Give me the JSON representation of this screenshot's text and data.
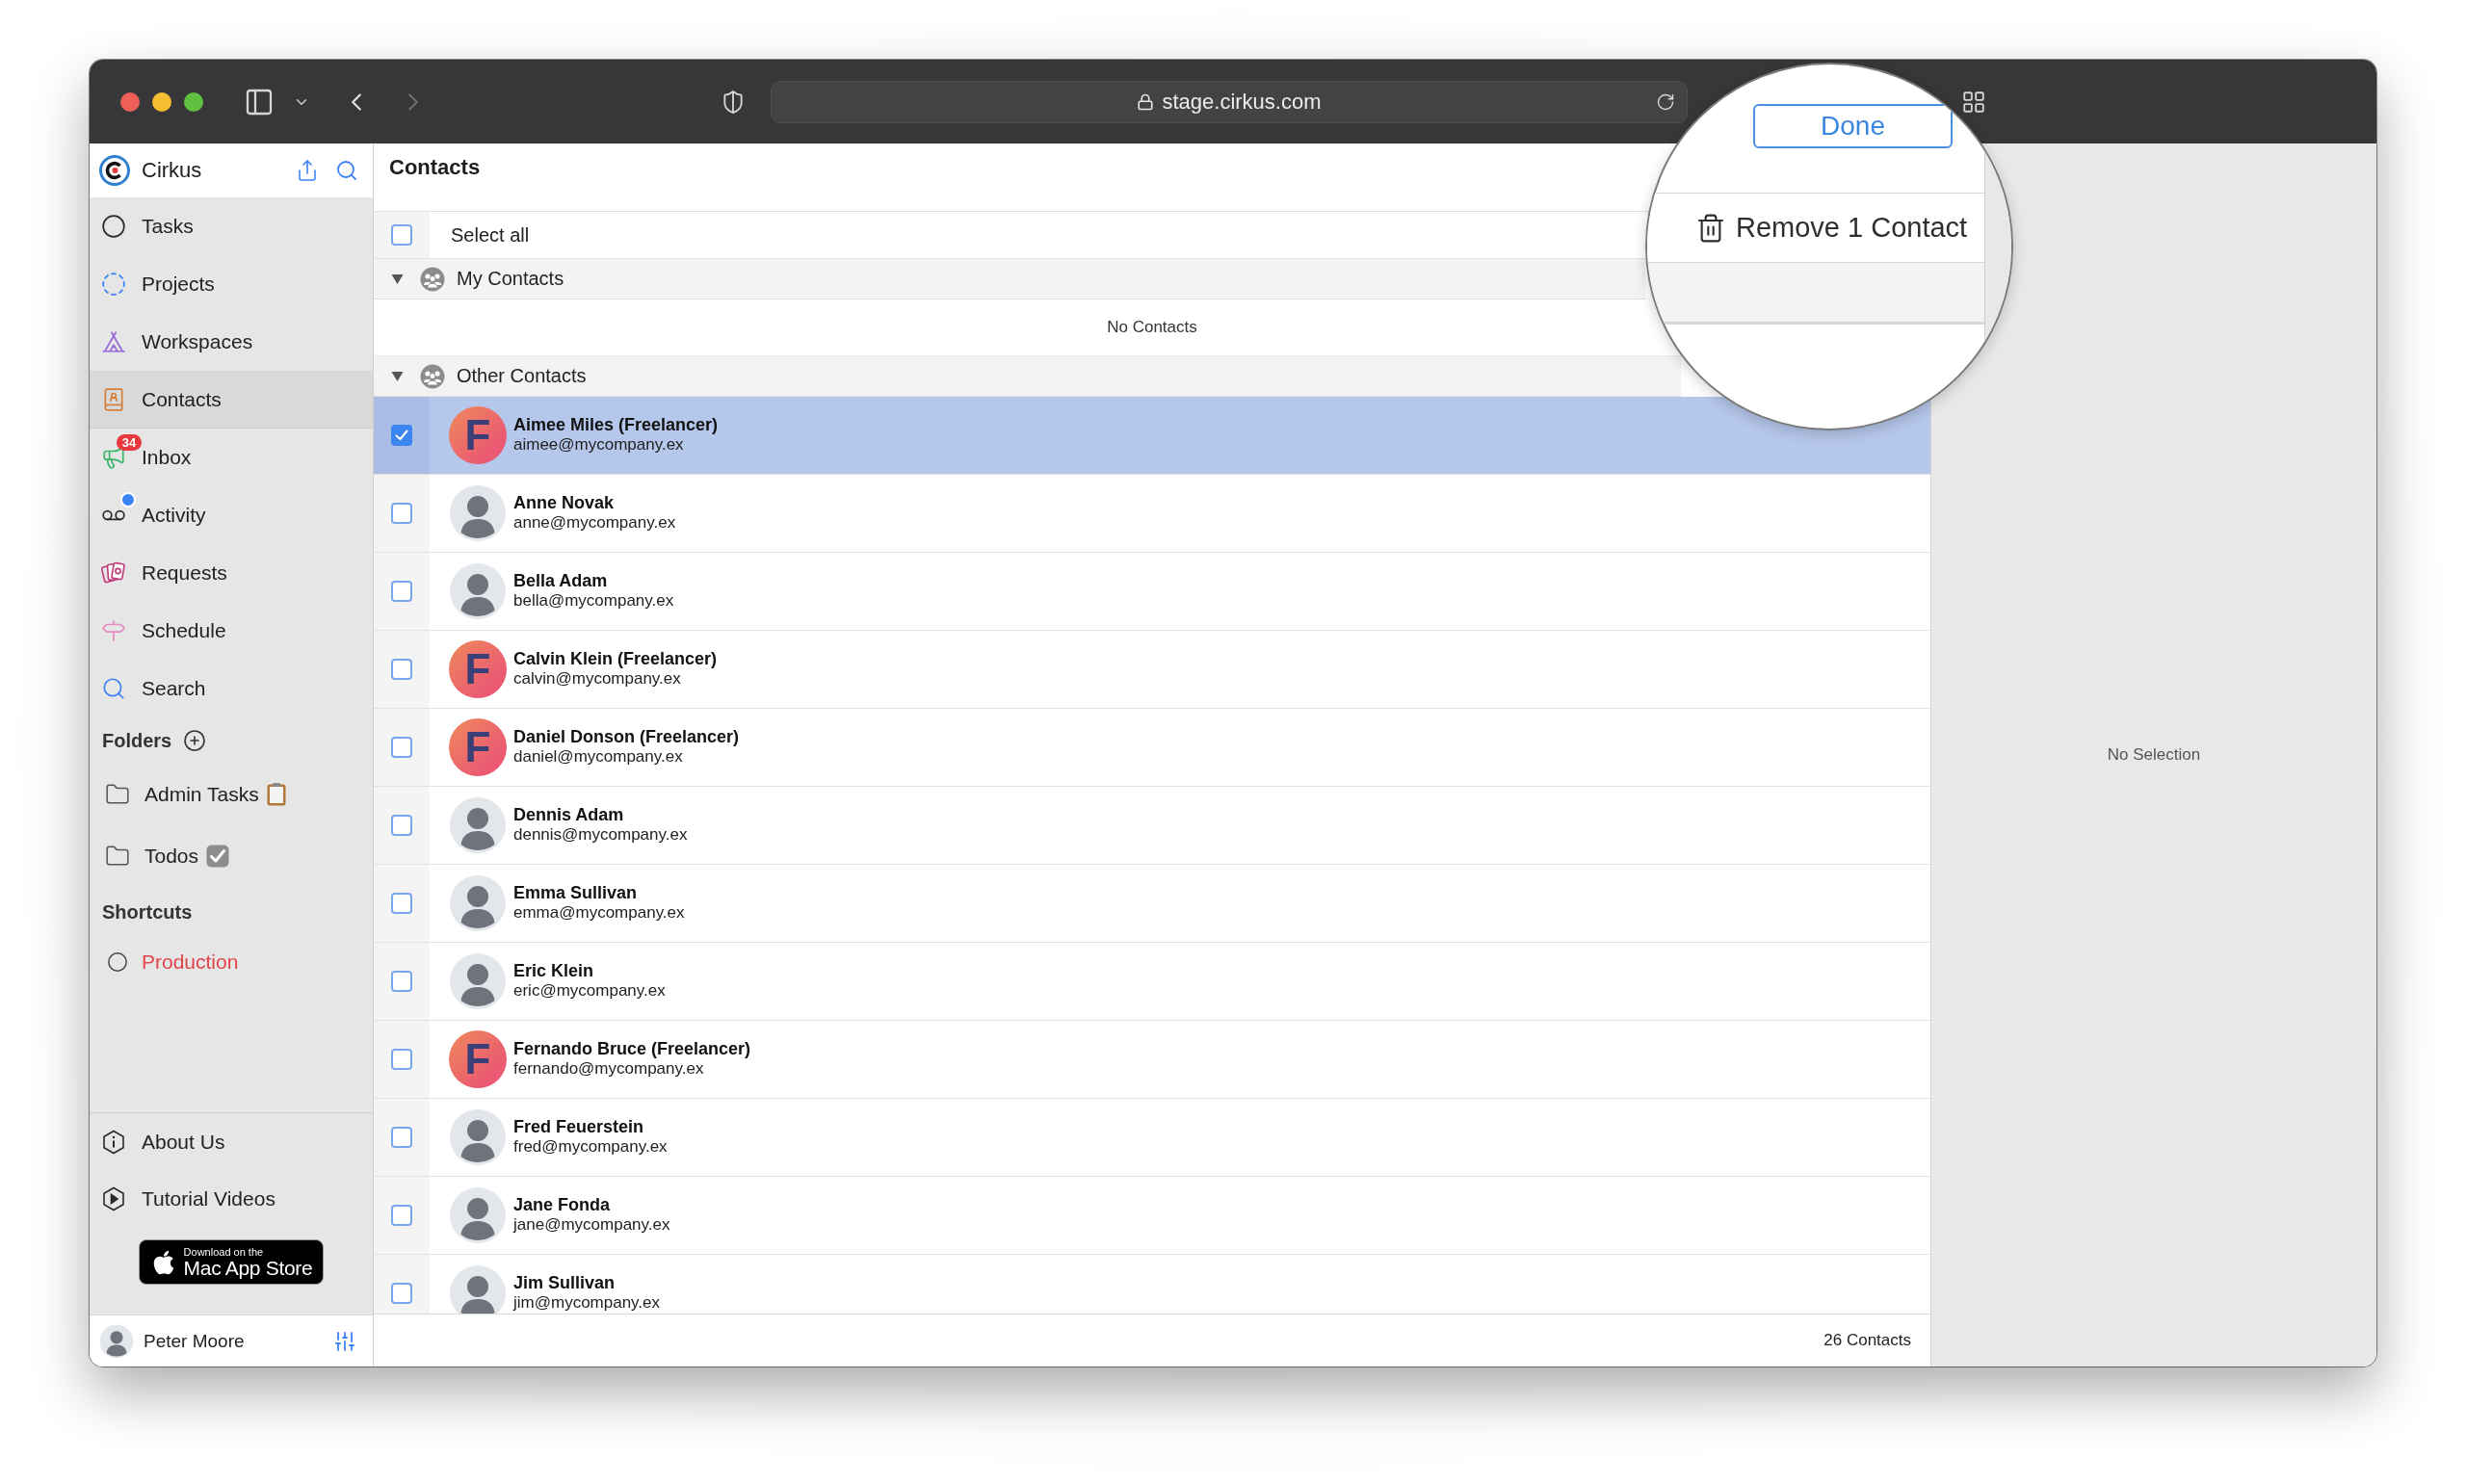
{
  "window": {
    "url": "stage.cirkus.com",
    "back_disabled": false,
    "forward_disabled": true
  },
  "sidebar": {
    "app_name": "Cirkus",
    "items": [
      {
        "label": "Tasks",
        "selected": false,
        "dot": false
      },
      {
        "label": "Projects",
        "selected": false,
        "dot": false
      },
      {
        "label": "Workspaces",
        "selected": false,
        "dot": false
      },
      {
        "label": "Contacts",
        "selected": true,
        "dot": false
      },
      {
        "label": "Inbox",
        "selected": false,
        "dot": false,
        "badge": "34"
      },
      {
        "label": "Activity",
        "selected": false,
        "dot": true
      },
      {
        "label": "Requests",
        "selected": false,
        "dot": false
      },
      {
        "label": "Schedule",
        "selected": false,
        "dot": false
      },
      {
        "label": "Search",
        "selected": false,
        "dot": false
      }
    ],
    "folders": {
      "title": "Folders",
      "items": [
        {
          "label": "Admin Tasks"
        },
        {
          "label": "Todos"
        }
      ]
    },
    "shortcuts": {
      "title": "Shortcuts",
      "items": [
        {
          "label": "Production",
          "color": "#e0444b"
        }
      ]
    },
    "links": [
      {
        "label": "About Us"
      },
      {
        "label": "Tutorial Videos"
      }
    ],
    "app_store": {
      "line_1": "Download on the",
      "line_2": "Mac App Store"
    },
    "user": {
      "name": "Peter Moore"
    }
  },
  "list": {
    "title": "Contacts",
    "select_all": {
      "label": "Select all",
      "checked": false
    },
    "groups": [
      {
        "name": "My Contacts",
        "expanded": true,
        "empty_text": "No Contacts"
      },
      {
        "name": "Other Contacts",
        "expanded": true,
        "contacts": [
          {
            "name": "Aimee Miles (Freelancer)",
            "email": "aimee@mycompany.ex",
            "avatar": {
              "kind": "initial",
              "text": "F"
            },
            "checked": true,
            "selected": true
          },
          {
            "name": "Anne Novak",
            "email": "anne@mycompany.ex",
            "avatar": {
              "kind": "person"
            },
            "checked": false,
            "selected": false
          },
          {
            "name": "Bella Adam",
            "email": "bella@mycompany.ex",
            "avatar": {
              "kind": "person"
            },
            "checked": false,
            "selected": false
          },
          {
            "name": "Calvin Klein (Freelancer)",
            "email": "calvin@mycompany.ex",
            "avatar": {
              "kind": "initial",
              "text": "F"
            },
            "checked": false,
            "selected": false
          },
          {
            "name": "Daniel Donson (Freelancer)",
            "email": "daniel@mycompany.ex",
            "avatar": {
              "kind": "initial",
              "text": "F"
            },
            "checked": false,
            "selected": false
          },
          {
            "name": "Dennis Adam",
            "email": "dennis@mycompany.ex",
            "avatar": {
              "kind": "person"
            },
            "checked": false,
            "selected": false
          },
          {
            "name": "Emma Sullivan",
            "email": "emma@mycompany.ex",
            "avatar": {
              "kind": "person"
            },
            "checked": false,
            "selected": false
          },
          {
            "name": "Eric Klein",
            "email": "eric@mycompany.ex",
            "avatar": {
              "kind": "person"
            },
            "checked": false,
            "selected": false
          },
          {
            "name": "Fernando Bruce (Freelancer)",
            "email": "fernando@mycompany.ex",
            "avatar": {
              "kind": "initial",
              "text": "F"
            },
            "checked": false,
            "selected": false
          },
          {
            "name": "Fred Feuerstein",
            "email": "fred@mycompany.ex",
            "avatar": {
              "kind": "person"
            },
            "checked": false,
            "selected": false
          },
          {
            "name": "Jane Fonda",
            "email": "jane@mycompany.ex",
            "avatar": {
              "kind": "person"
            },
            "checked": false,
            "selected": false
          },
          {
            "name": "Jim Sullivan",
            "email": "jim@mycompany.ex",
            "avatar": {
              "kind": "person"
            },
            "checked": false,
            "selected": false
          }
        ]
      }
    ],
    "footer": "26 Contacts"
  },
  "magnifier": {
    "done_button": "Done",
    "remove_button": "Remove 1 Contact"
  },
  "detail": {
    "empty_text": "No Selection"
  }
}
